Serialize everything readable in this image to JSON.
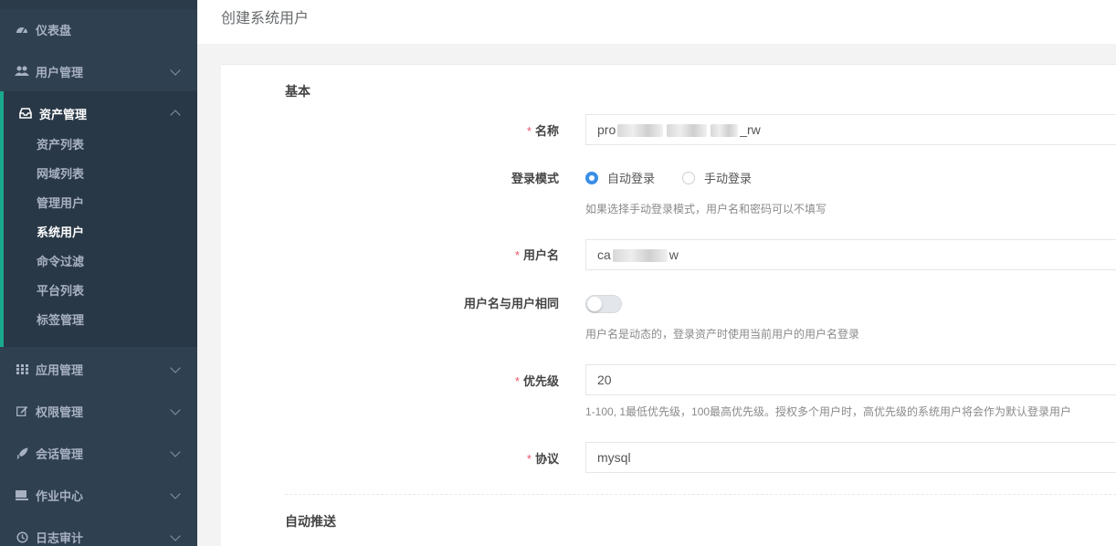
{
  "sidebar": {
    "top_items": [
      {
        "label": "仪表盘",
        "icon": "dashboard-icon"
      },
      {
        "label": "用户管理",
        "icon": "users-icon"
      }
    ],
    "active_group": {
      "label": "资产管理",
      "icon": "inbox-icon",
      "children": [
        "资产列表",
        "网域列表",
        "管理用户",
        "系统用户",
        "命令过滤",
        "平台列表",
        "标签管理"
      ],
      "active_child": "系统用户"
    },
    "bottom_items": [
      {
        "label": "应用管理",
        "icon": "grid-icon"
      },
      {
        "label": "权限管理",
        "icon": "edit-icon"
      },
      {
        "label": "会话管理",
        "icon": "rocket-icon"
      },
      {
        "label": "作业中心",
        "icon": "terminal-icon"
      },
      {
        "label": "日志审计",
        "icon": "history-icon"
      }
    ]
  },
  "header": {
    "title": "创建系统用户"
  },
  "form": {
    "section_basic": "基本",
    "name_label": "名称",
    "name_value_start": "pro",
    "name_value_end": "_rw",
    "login_mode_label": "登录模式",
    "login_mode_options": [
      "自动登录",
      "手动登录"
    ],
    "login_mode_selected": "自动登录",
    "login_mode_help": "如果选择手动登录模式，用户名和密码可以不填写",
    "username_label": "用户名",
    "username_value_start": "ca",
    "username_value_end": "w",
    "same_user_label": "用户名与用户相同",
    "same_user_on": false,
    "same_user_help": "用户名是动态的，登录资产时使用当前用户的用户名登录",
    "priority_label": "优先级",
    "priority_value": "20",
    "priority_help": "1-100, 1最低优先级，100最高优先级。授权多个用户时，高优先级的系统用户将会作为默认登录用户",
    "protocol_label": "协议",
    "protocol_value": "mysql",
    "section_push": "自动推送"
  },
  "colors": {
    "sidebar_bg": "#2f4050",
    "accent": "#19aa8d",
    "radio_checked": "#3a8ee6",
    "required": "#ed5565"
  }
}
